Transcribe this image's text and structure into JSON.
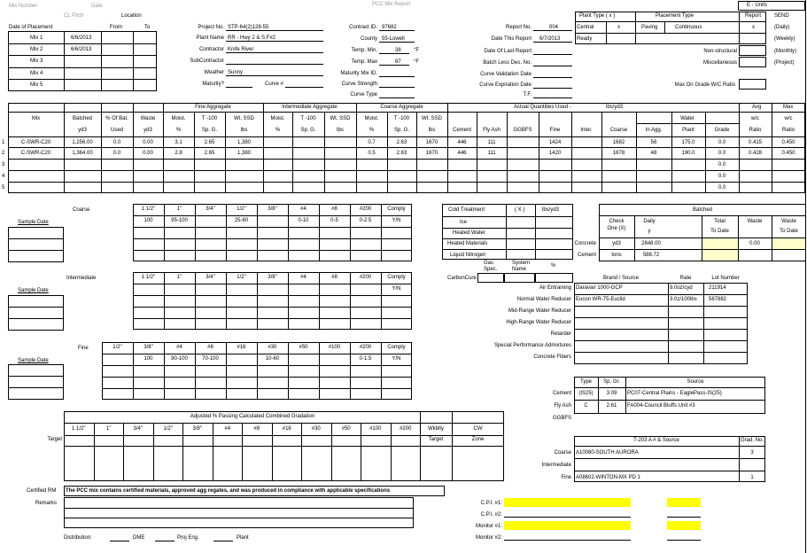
{
  "top": {
    "left1": "Mix Number",
    "left2": "Date",
    "center": "PCC Mix Report",
    "e_units": "E - Units"
  },
  "placement": {
    "cl_pitch": "CL Pitch",
    "location": "Location",
    "date_label": "Date of Placement",
    "from": "From",
    "to": "To",
    "mixes": [
      {
        "label": "Mix 1",
        "date": "6/6/2013"
      },
      {
        "label": "Mix 2",
        "date": "6/6/2013"
      },
      {
        "label": "Mix 3",
        "date": ""
      },
      {
        "label": "Mix 4",
        "date": ""
      },
      {
        "label": "Mix 5",
        "date": ""
      }
    ]
  },
  "project": {
    "project_no_label": "Project No.",
    "project_no": "STP-64(2)128-55",
    "plant_name_label": "Plant Name",
    "plant_name": "RR - Hwy 2 & S.F#2",
    "contractor_label": "Contractor",
    "contractor": "Knife River",
    "subcontractor_label": "SubContractor",
    "weather_label": "Weather",
    "weather": "Sunny",
    "maturity_label": "Maturity?",
    "curve_label": "Curve #",
    "contract_id_label": "Contract ID.",
    "contract_id": "97682",
    "county_label": "County",
    "county": "55-Lowell",
    "temp_min_label": "Temp. Min.",
    "temp_min": "38",
    "temp_min_unit": "°F",
    "temp_max_label": "Temp. Max",
    "temp_max": "87",
    "temp_max_unit": "°F",
    "maturity_mix_label": "Maturity Mix ID.",
    "curve_strength_label": "Curve Strength",
    "curve_type_label": "Curve Type"
  },
  "report": {
    "report_no_label": "Report No.",
    "report_no": "004",
    "date_report_label": "Date This Report",
    "date_report": "6/7/2013",
    "last_report_label": "Date Of Last Report",
    "batch_label": "Batch Less Des. No.",
    "curve_val_label": "Curve Validation Date",
    "curve_exp_label": "Curve Expiration Date",
    "tf_label": "T.F."
  },
  "plant_type": {
    "title": "Plant Type ( x )",
    "central": "Central",
    "central_x": "x",
    "ready": "Ready"
  },
  "placement_type": {
    "title": "Placement Type",
    "paving": "Paving",
    "continuous": "Continuous",
    "non_structural": "Non-structural",
    "miscellaneous": "Miscellaneous",
    "max_grade": "Max On Grade W/C Ratio"
  },
  "report_type": {
    "title": "Report",
    "x": "x",
    "send": "SEND",
    "daily": "(Daily)",
    "weekly": "(Weekly)",
    "monthly": "(Monthly)",
    "project": "(Project)"
  },
  "mix_table": {
    "grp_fine": "Fine Aggregate",
    "grp_inter": "Intermediate Aggregate",
    "grp_coarse": "Coarse Aggregate",
    "grp_actual": "Actual Quantities Used -",
    "lbs_yd3": "lbs/yd3",
    "grp_water": "Water",
    "avg": "Avg",
    "max": "Max",
    "hdr_mix": "Mix",
    "hdr_batched": "Batched",
    "hdr_batched2": "yd3",
    "hdr_pctbat": "% Of Bat.",
    "hdr_pctbat2": "Used",
    "hdr_waste": "Waste",
    "hdr_waste2": "yd3",
    "hdr_moist": "Moist.",
    "hdr_moist2": "%",
    "hdr_t100": "T -100",
    "hdr_t100b": "Sp. G.",
    "hdr_wtssd": "Wt. SSD",
    "hdr_wtssd2": "lbs",
    "hdr_cement": "Cement",
    "hdr_flyash": "Fly Ash",
    "hdr_ggbfs": "GGBFS",
    "hdr_fine": "Fine",
    "hdr_inter": "Inter.",
    "hdr_coarse": "Coarse",
    "hdr_inagg": "In Agg.",
    "hdr_plant": "Plant",
    "hdr_grade": "Grade",
    "hdr_wc": "w/c",
    "hdr_ratio": "Ratio",
    "rows": [
      {
        "n": "1",
        "mix": "C-SWR-C20",
        "batched": "1,256.00",
        "pct": "0.0",
        "waste": "0.00",
        "fm": "3.1",
        "fs": "2.65",
        "fw": "1,380",
        "cm": "0.7",
        "cs": "2.63",
        "cw": "1670",
        "cement": "446",
        "flyash": "111",
        "ggbfs": "",
        "fine": "1424",
        "inter": "",
        "coarse": "1682",
        "inagg": "56",
        "plant": "175.0",
        "grade": "0.0",
        "avg": "0.415",
        "max": "0.450"
      },
      {
        "n": "2",
        "mix": "C-SWR-C20",
        "batched": "1,364.00",
        "pct": "0.0",
        "waste": "0.00",
        "fm": "2.8",
        "fs": "2.65",
        "fw": "1,380",
        "cm": "0.5",
        "cs": "2.63",
        "cw": "1670",
        "cement": "446",
        "flyash": "111",
        "ggbfs": "",
        "fine": "1420",
        "inter": "",
        "coarse": "1678",
        "inagg": "48",
        "plant": "190.0",
        "grade": "0.0",
        "avg": "0.428",
        "max": "0.450"
      },
      {
        "n": "3",
        "mix": "",
        "batched": "",
        "pct": "",
        "waste": "",
        "fm": "",
        "fs": "",
        "fw": "",
        "cm": "",
        "cs": "",
        "cw": "",
        "cement": "",
        "flyash": "",
        "ggbfs": "",
        "fine": "",
        "inter": "",
        "coarse": "",
        "inagg": "",
        "plant": "",
        "grade": "0.0",
        "avg": "",
        "max": ""
      },
      {
        "n": "4",
        "mix": "",
        "batched": "",
        "pct": "",
        "waste": "",
        "fm": "",
        "fs": "",
        "fw": "",
        "cm": "",
        "cs": "",
        "cw": "",
        "cement": "",
        "flyash": "",
        "ggbfs": "",
        "fine": "",
        "inter": "",
        "coarse": "",
        "inagg": "",
        "plant": "",
        "grade": "0.0",
        "avg": "",
        "max": ""
      },
      {
        "n": "5",
        "mix": "",
        "batched": "",
        "pct": "",
        "waste": "",
        "fm": "",
        "fs": "",
        "fw": "",
        "cm": "",
        "cs": "",
        "cw": "",
        "cement": "",
        "flyash": "",
        "ggbfs": "",
        "fine": "",
        "inter": "",
        "coarse": "",
        "inagg": "",
        "plant": "",
        "grade": "0.0",
        "avg": "",
        "max": ""
      }
    ]
  },
  "coarse_grad": {
    "title": "Coarse",
    "sample_date": "Sample Date",
    "sieves": [
      "1 1/2\"",
      "1\"",
      "3/4\"",
      "1/2\"",
      "3/8\"",
      "#4",
      "#8",
      "#200",
      "Comply"
    ],
    "spec": [
      "100",
      "95-100",
      "",
      "25-60",
      "",
      "0-10",
      "0-5",
      "0-2.5",
      "Y/N"
    ]
  },
  "inter_grad": {
    "title": "Intermediate",
    "sample_date": "Sample Date",
    "sieves": [
      "1 1/2\"",
      "1\"",
      "3/4\"",
      "1/2\"",
      "3/8\"",
      "#4",
      "#8",
      "#200",
      "Comply"
    ],
    "spec": [
      "",
      "",
      "",
      "",
      "",
      "",
      "",
      "",
      "Y/N"
    ]
  },
  "fine_grad": {
    "title": "Fine",
    "sample_date": "Sample Date",
    "sieves": [
      "1/2\"",
      "3/8\"",
      "#4",
      "#8",
      "#16",
      "#30",
      "#50",
      "#100",
      "#200",
      "Comply"
    ],
    "spec": [
      "",
      "100",
      "90-100",
      "70-100",
      "",
      "10-60",
      "",
      "",
      "0-1.5",
      "Y/N"
    ]
  },
  "treatment": {
    "cold_weather": "Cold Treatment",
    "x": "( X )",
    "lbs_yd3": "lbs/yd3",
    "ice": "Ice",
    "heated_water": "Heated Water",
    "heated_materials": "Heated Materials",
    "liquid_nitrogen": "Liquid Nitrogen",
    "gas_label": "Gas",
    "gas_sub": "Spec.",
    "system_label": "System",
    "system_sub": "Name",
    "pct": "%",
    "carbon_cure": "CarbonCure"
  },
  "batched": {
    "title": "Batched",
    "check": "Check",
    "one_x": "One (X)",
    "daily": "Daily",
    "y": "y",
    "total": "Total",
    "to_date": "To Date",
    "waste": "Waste",
    "waste2": "Waste",
    "to_date2": "To Date",
    "concrete_label": "Concrete",
    "concrete_unit": "yd3",
    "concrete_daily": "2848.00",
    "waste_val": "0.00",
    "cement_label": "Cement",
    "cement_unit": "tons",
    "cement_daily": "588.72"
  },
  "admix": {
    "brand_hdr": "Brand / Source",
    "rate_hdr": "Rate",
    "lot_hdr": "Lot Number",
    "items": [
      {
        "label": "Air Entraining",
        "brand": "Daravair 1000-GCP",
        "rate": "8.0oz/cyd",
        "lot": "211914"
      },
      {
        "label": "Normal Water Reducer",
        "brand": "Eucon WR-75-Euclid",
        "rate": "3.0z/100lbs",
        "lot": "567882"
      },
      {
        "label": "Mid-Range Water Reducer",
        "brand": "",
        "rate": "",
        "lot": ""
      },
      {
        "label": "High-Range Water Reducer",
        "brand": "",
        "rate": "",
        "lot": ""
      },
      {
        "label": "Retarder",
        "brand": "",
        "rate": "",
        "lot": ""
      },
      {
        "label": "Special Performance Admixtures",
        "brand": "",
        "rate": "",
        "lot": ""
      },
      {
        "label": "Concrete Fibers",
        "brand": "",
        "rate": "",
        "lot": ""
      }
    ]
  },
  "cementitious": {
    "type_hdr": "Type",
    "spgr_hdr": "Sp. Gr.",
    "source_hdr": "Source",
    "items": [
      {
        "label": "Cement",
        "type": "(IS25)",
        "spgr": "3.09",
        "source": "PC07-Central Plains - EaglePass-IS(25)"
      },
      {
        "label": "Fly Ash",
        "type": "C",
        "spgr": "2.61",
        "source": "FA004-Council Bluffs Unit #3"
      },
      {
        "label": "GGBFS",
        "type": "",
        "spgr": "",
        "source": ""
      }
    ]
  },
  "t203": {
    "title": "T-203 A # & Source",
    "grad_hdr": "Grad. No.",
    "items": [
      {
        "label": "Coarse",
        "source": "A10080-SOUTH AURORA",
        "grad": "3"
      },
      {
        "label": "Intermediate",
        "source": "",
        "grad": ""
      },
      {
        "label": "Fine",
        "source": "A08602-WINTON-MX PD 1",
        "grad": "1"
      }
    ]
  },
  "adjusted": {
    "title": "Adjusted % Passing Calculated Combined Gradation",
    "target": "Target",
    "sieves": [
      "1 1/2\"",
      "1\"",
      "3/4\"",
      "1/2\"",
      "3/8\"",
      "#4",
      "#8",
      "#16",
      "#30",
      "#50",
      "#100",
      "#200"
    ],
    "wf": "Wkblty",
    "wf2": "Target",
    "cw": "CW",
    "cw2": "Zone"
  },
  "footer": {
    "certified_rm": "Certified RM",
    "cert_text": "The PCC mix contains certified materials, approved agg regates, and was produced in compliance with applicable specifications",
    "remarks": "Remarks",
    "cpi1": "C.P.I. #1:",
    "cpi2": "C.P.I. #2:",
    "monitor1": "Monitor #1:",
    "monitor2": "Monitor #2:",
    "distribution": "Distribution:",
    "dme": "DME",
    "proj_eng": "Proj Eng.",
    "plant": "Plant"
  },
  "colors": {
    "highlight": "#ffff00",
    "light": "#ffffcc"
  }
}
